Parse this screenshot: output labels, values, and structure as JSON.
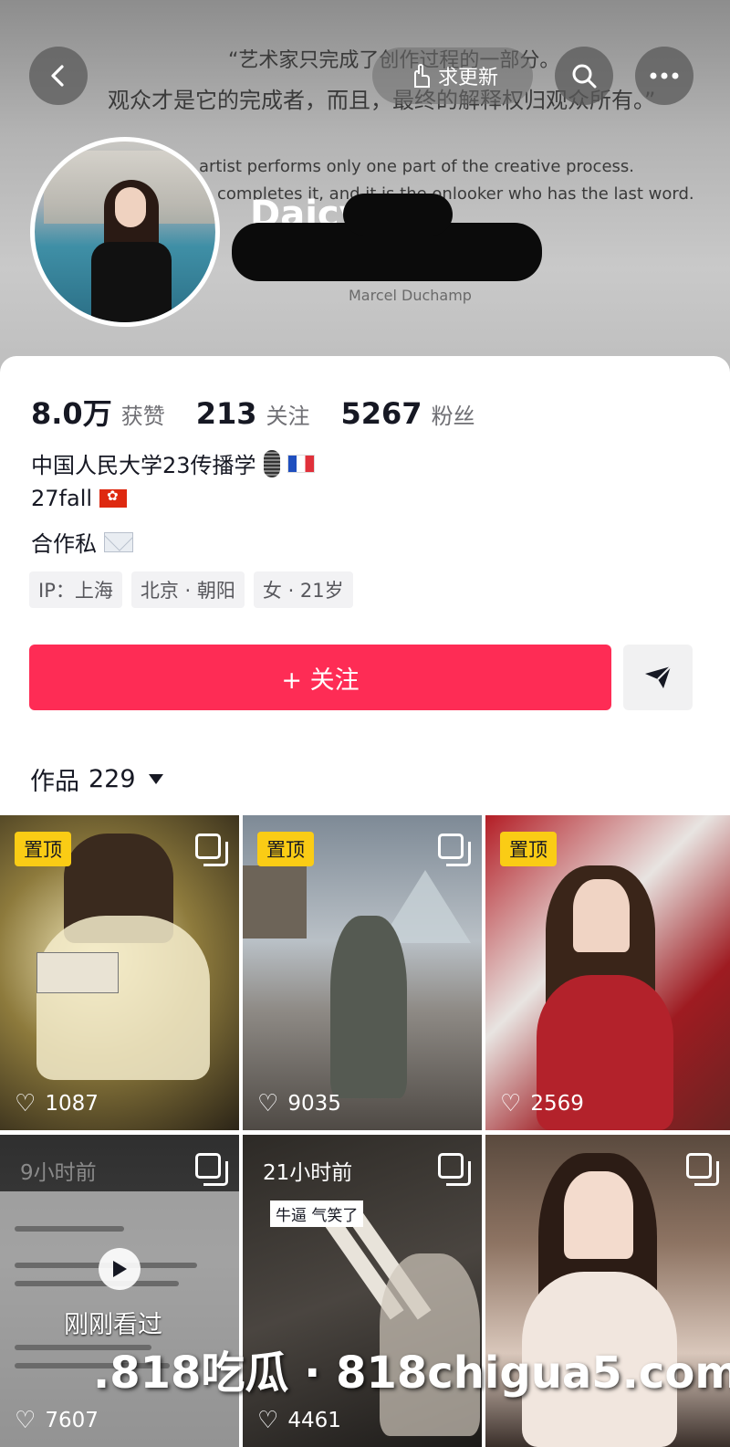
{
  "header": {
    "quote_zh_1": "“艺术家只完成了创作过程的一部分。",
    "quote_zh_2": "观众才是它的完成者，而且，最终的解释权归观众所有。”",
    "quote_en_1": "artist performs only one part of the creative process.",
    "quote_en_2": "completes it, and it is the onlooker who has the last word.",
    "quote_author": "Marcel Duchamp",
    "update_label": "求更新",
    "username": "Daicy"
  },
  "stats": {
    "likes_value": "8.0万",
    "likes_label": "获赞",
    "following_value": "213",
    "following_label": "关注",
    "followers_value": "5267",
    "followers_label": "粉丝"
  },
  "bio": {
    "line1": "中国人民大学23传播学",
    "line2": "27fall",
    "line3": "合作私"
  },
  "tags": [
    "IP：上海",
    "北京 · 朝阳",
    "女 · 21岁"
  ],
  "actions": {
    "follow_label": "+ 关注"
  },
  "works": {
    "label": "作品",
    "count": "229"
  },
  "grid": [
    {
      "pin": "置顶",
      "likes": "1087"
    },
    {
      "pin": "置顶",
      "likes": "9035"
    },
    {
      "pin": "置顶",
      "likes": "2569"
    },
    {
      "time": "9小时前",
      "watched": "刚刚看过",
      "likes": "7607"
    },
    {
      "time": "21小时前",
      "caption": "牛逼 气笑了",
      "likes": "4461"
    },
    {
      "likes": ""
    }
  ],
  "watermark": ".818吃瓜 · 818chigua5.com",
  "colors": {
    "accent": "#fe2c55",
    "pin": "#facc15"
  }
}
